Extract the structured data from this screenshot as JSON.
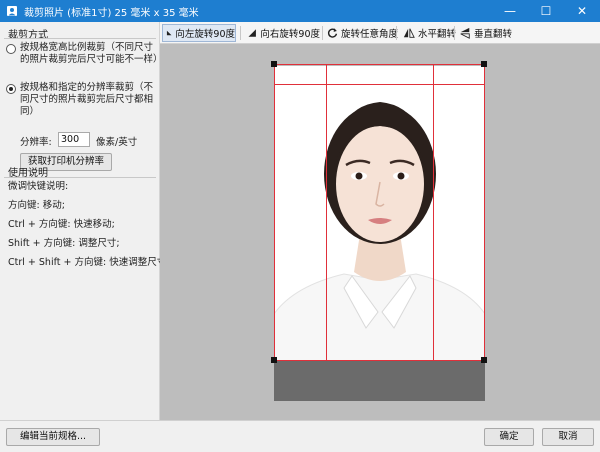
{
  "window": {
    "title": "裁剪照片 (标准1寸) 25 毫米 x 35 毫米",
    "minimize_label": "—",
    "maximize_label": "☐",
    "close_label": "✕"
  },
  "crop_mode": {
    "section_label": "裁剪方式",
    "option_ratio_label": "按规格宽高比例裁剪（不同尺寸的照片裁剪完后尺寸可能不一样）",
    "option_resolution_label": "按规格和指定的分辨率裁剪（不同尺寸的照片裁剪完后尺寸都相同）",
    "selected_option": "resolution",
    "resolution_label": "分辨率:",
    "resolution_value": "300",
    "resolution_unit": "像素/英寸",
    "get_printer_resolution_button": "获取打印机分辨率"
  },
  "instructions": {
    "section_label": "使用说明",
    "lines": [
      "微调快键说明:",
      "方向键: 移动;",
      "Ctrl + 方向键: 快速移动;",
      "Shift + 方向键: 调整尺寸;",
      "Ctrl + Shift + 方向键: 快速调整尺寸。"
    ]
  },
  "toolbar": {
    "rotate_left_label": "向左旋转90度",
    "rotate_right_label": "向右旋转90度",
    "rotate_any_label": "旋转任意角度",
    "flip_horizontal_label": "水平翻转",
    "flip_vertical_label": "垂直翻转",
    "active_tool": "rotate_left"
  },
  "footer": {
    "edit_spec_button": "编辑当前规格...",
    "ok_button": "确定",
    "cancel_button": "取消"
  },
  "colors": {
    "titlebar": "#1e7ed0",
    "crop_line": "#e0303a",
    "canvas_bg": "#bdbdbd",
    "mask": "#6b6b6b"
  },
  "icons": {
    "app": "crop-photo-icon",
    "rotate_left": "rotate-left-icon",
    "rotate_right": "rotate-right-icon",
    "rotate_any": "rotate-any-icon",
    "flip_horizontal": "flip-horizontal-icon",
    "flip_vertical": "flip-vertical-icon"
  }
}
